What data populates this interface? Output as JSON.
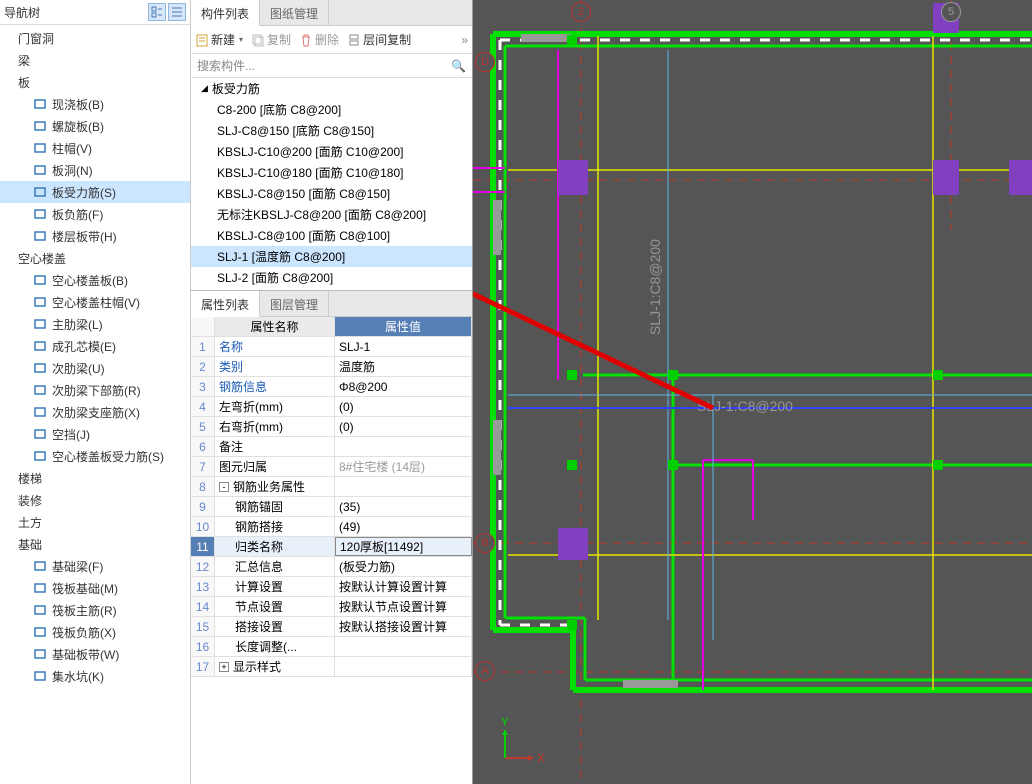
{
  "left_panel": {
    "title": "导航树",
    "groups": [
      {
        "label": "门窗洞",
        "items": []
      },
      {
        "label": "梁",
        "items": []
      },
      {
        "label": "板",
        "items": [
          {
            "label": "现浇板(B)",
            "ic": "rect-b"
          },
          {
            "label": "螺旋板(B)",
            "ic": "spiral"
          },
          {
            "label": "柱帽(V)",
            "ic": "cap"
          },
          {
            "label": "板洞(N)",
            "ic": "hole"
          },
          {
            "label": "板受力筋(S)",
            "ic": "rebar",
            "active": true
          },
          {
            "label": "板负筋(F)",
            "ic": "neg"
          },
          {
            "label": "楼层板带(H)",
            "ic": "band"
          }
        ]
      },
      {
        "label": "空心楼盖",
        "items": [
          {
            "label": "空心楼盖板(B)",
            "ic": "grid-b"
          },
          {
            "label": "空心楼盖柱帽(V)",
            "ic": "grid-v"
          },
          {
            "label": "主肋梁(L)",
            "ic": "beam"
          },
          {
            "label": "成孔芯模(E)",
            "ic": "core"
          },
          {
            "label": "次肋梁(U)",
            "ic": "sec"
          },
          {
            "label": "次肋梁下部筋(R)",
            "ic": "bot"
          },
          {
            "label": "次肋梁支座筋(X)",
            "ic": "sup"
          },
          {
            "label": "空挡(J)",
            "ic": "gap"
          },
          {
            "label": "空心楼盖板受力筋(S)",
            "ic": "sreb"
          }
        ]
      },
      {
        "label": "楼梯",
        "items": []
      },
      {
        "label": "装修",
        "items": []
      },
      {
        "label": "土方",
        "items": []
      },
      {
        "label": "基础",
        "items": [
          {
            "label": "基础梁(F)",
            "ic": "fb"
          },
          {
            "label": "筏板基础(M)",
            "ic": "raft"
          },
          {
            "label": "筏板主筋(R)",
            "ic": "raftr"
          },
          {
            "label": "筏板负筋(X)",
            "ic": "raftn"
          },
          {
            "label": "基础板带(W)",
            "ic": "bband"
          },
          {
            "label": "集水坑(K)",
            "ic": "sump"
          }
        ]
      }
    ]
  },
  "mid_panel": {
    "tabs": {
      "list": "构件列表",
      "draw": "图纸管理"
    },
    "toolbar": {
      "new": "新建",
      "copy": "复制",
      "del": "删除",
      "floor_copy": "层间复制"
    },
    "search_placeholder": "搜索构件...",
    "component_header": "板受力筋",
    "components": [
      "C8-200 [底筋 C8@200]",
      "SLJ-C8@150 [底筋 C8@150]",
      "KBSLJ-C10@200 [面筋 C10@200]",
      "KBSLJ-C10@180 [面筋 C10@180]",
      "KBSLJ-C8@150 [面筋 C8@150]",
      "无标注KBSLJ-C8@200 [面筋 C8@200]",
      "KBSLJ-C8@100 [面筋 C8@100]",
      "SLJ-1 [温度筋 C8@200]",
      "SLJ-2 [面筋 C8@200]"
    ],
    "selected_component_idx": 7,
    "prop_tabs": {
      "list": "属性列表",
      "layer": "图层管理"
    },
    "prop_headers": {
      "name": "属性名称",
      "value": "属性值"
    },
    "props": [
      {
        "n": "1",
        "k": "名称",
        "v": "SLJ-1",
        "blue": true
      },
      {
        "n": "2",
        "k": "类别",
        "v": "温度筋",
        "blue": true
      },
      {
        "n": "3",
        "k": "钢筋信息",
        "v": "Φ8@200",
        "blue": true
      },
      {
        "n": "4",
        "k": "左弯折(mm)",
        "v": "(0)"
      },
      {
        "n": "5",
        "k": "右弯折(mm)",
        "v": "(0)"
      },
      {
        "n": "6",
        "k": "备注",
        "v": ""
      },
      {
        "n": "7",
        "k": "图元归属",
        "v": "8#住宅楼 (14层)",
        "dim": true
      },
      {
        "n": "8",
        "k": "钢筋业务属性",
        "v": "",
        "exp": "-"
      },
      {
        "n": "9",
        "k": "钢筋锚固",
        "v": "(35)",
        "ind": 1
      },
      {
        "n": "10",
        "k": "钢筋搭接",
        "v": "(49)",
        "ind": 1
      },
      {
        "n": "11",
        "k": "归类名称",
        "v": "120厚板[11492]",
        "ind": 1,
        "sel": true,
        "box": true
      },
      {
        "n": "12",
        "k": "汇总信息",
        "v": "(板受力筋)",
        "ind": 1
      },
      {
        "n": "13",
        "k": "计算设置",
        "v": "按默认计算设置计算",
        "ind": 1
      },
      {
        "n": "14",
        "k": "节点设置",
        "v": "按默认节点设置计算",
        "ind": 1
      },
      {
        "n": "15",
        "k": "搭接设置",
        "v": "按默认搭接设置计算",
        "ind": 1
      },
      {
        "n": "16",
        "k": "长度调整(...",
        "v": "",
        "ind": 1
      },
      {
        "n": "17",
        "k": "显示样式",
        "v": "",
        "exp": "+"
      }
    ]
  },
  "canvas": {
    "grid_labels": {
      "top1": "2",
      "top2": "5",
      "leftD": "D",
      "leftB": "B",
      "leftA": "A"
    },
    "anno1": "SLJ-1:C8@200",
    "anno2": "SLJ-1:C8@200",
    "axis_x": "X",
    "axis_y": "Y"
  }
}
